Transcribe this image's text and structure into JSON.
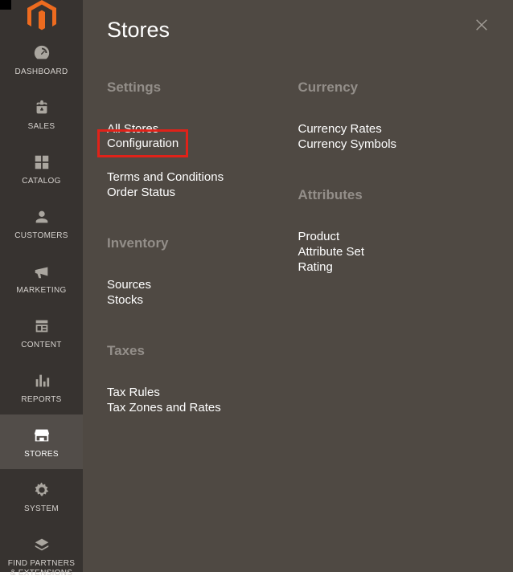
{
  "sidebar": {
    "items": [
      {
        "label": "DASHBOARD"
      },
      {
        "label": "SALES"
      },
      {
        "label": "CATALOG"
      },
      {
        "label": "CUSTOMERS"
      },
      {
        "label": "MARKETING"
      },
      {
        "label": "CONTENT"
      },
      {
        "label": "REPORTS"
      },
      {
        "label": "STORES"
      },
      {
        "label": "SYSTEM"
      },
      {
        "label": "FIND PARTNERS\n& EXTENSIONS"
      }
    ]
  },
  "flyout": {
    "title": "Stores",
    "sections": {
      "settings": {
        "title": "Settings",
        "links": [
          "All Stores",
          "Configuration",
          "Terms and Conditions",
          "Order Status"
        ]
      },
      "inventory": {
        "title": "Inventory",
        "links": [
          "Sources",
          "Stocks"
        ]
      },
      "taxes": {
        "title": "Taxes",
        "links": [
          "Tax Rules",
          "Tax Zones and Rates"
        ]
      },
      "currency": {
        "title": "Currency",
        "links": [
          "Currency Rates",
          "Currency Symbols"
        ]
      },
      "attributes": {
        "title": "Attributes",
        "links": [
          "Product",
          "Attribute Set",
          "Rating"
        ]
      }
    }
  }
}
